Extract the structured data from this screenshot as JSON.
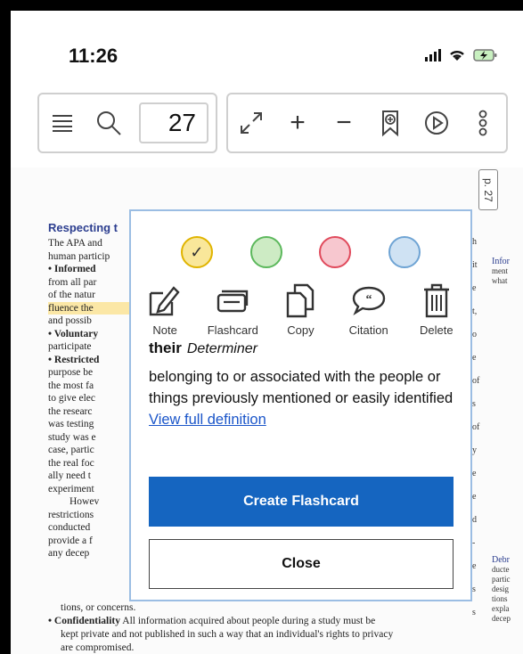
{
  "status": {
    "time": "11:26"
  },
  "toolbar": {
    "page_number": "27"
  },
  "document": {
    "page_tag": "p. 27",
    "heading": "Respecting t",
    "lines": [
      "The APA and",
      "human particip",
      "• Informed",
      "from all par",
      "of the natur",
      "fluence the",
      "and possib",
      "• Voluntary",
      "participate",
      "• Restricted",
      "purpose be",
      "the most fa",
      "to give elec",
      "the researc",
      "was testing",
      "study was e",
      "case, partic",
      "the real foc",
      "ally need t",
      "experiment",
      "Howev",
      "restrictions",
      "conducted",
      "provide a f",
      "any decep"
    ],
    "bottom_lines": [
      "tions, or concerns.",
      "• Confidentiality All information acquired about people during a study must be",
      "kept private and not published in such a way that an individual's rights to privacy",
      "are compromised."
    ],
    "right_edge": [
      "h",
      "it",
      "e",
      "t,",
      "o",
      "e",
      "of",
      "s",
      "of",
      "y",
      "e",
      "e",
      "d",
      "-",
      "e",
      "s",
      "s"
    ],
    "margin_top": [
      "Infor",
      "ment",
      "what"
    ],
    "margin_bottom": [
      "Debr",
      "ducte",
      "partic",
      "desig",
      "tions",
      "expla",
      "decep"
    ]
  },
  "popup": {
    "colors": [
      {
        "name": "yellow",
        "fill": "#f9e79a",
        "stroke": "#e0b400",
        "checked": "✓"
      },
      {
        "name": "green",
        "fill": "#cdebc4",
        "stroke": "#5cb85c",
        "checked": ""
      },
      {
        "name": "pink",
        "fill": "#f7c7cf",
        "stroke": "#e04a5c",
        "checked": ""
      },
      {
        "name": "blue",
        "fill": "#cfe2f3",
        "stroke": "#6fa4d4",
        "checked": ""
      }
    ],
    "actions": {
      "note": "Note",
      "flashcard": "Flashcard",
      "copy": "Copy",
      "citation": "Citation",
      "delete": "Delete"
    },
    "word": "their",
    "part_of_speech": "Determiner",
    "definition": "belonging to or associated with the people or things previously mentioned or easily identified",
    "link": "View full definition",
    "primary_button": "Create Flashcard",
    "secondary_button": "Close"
  }
}
